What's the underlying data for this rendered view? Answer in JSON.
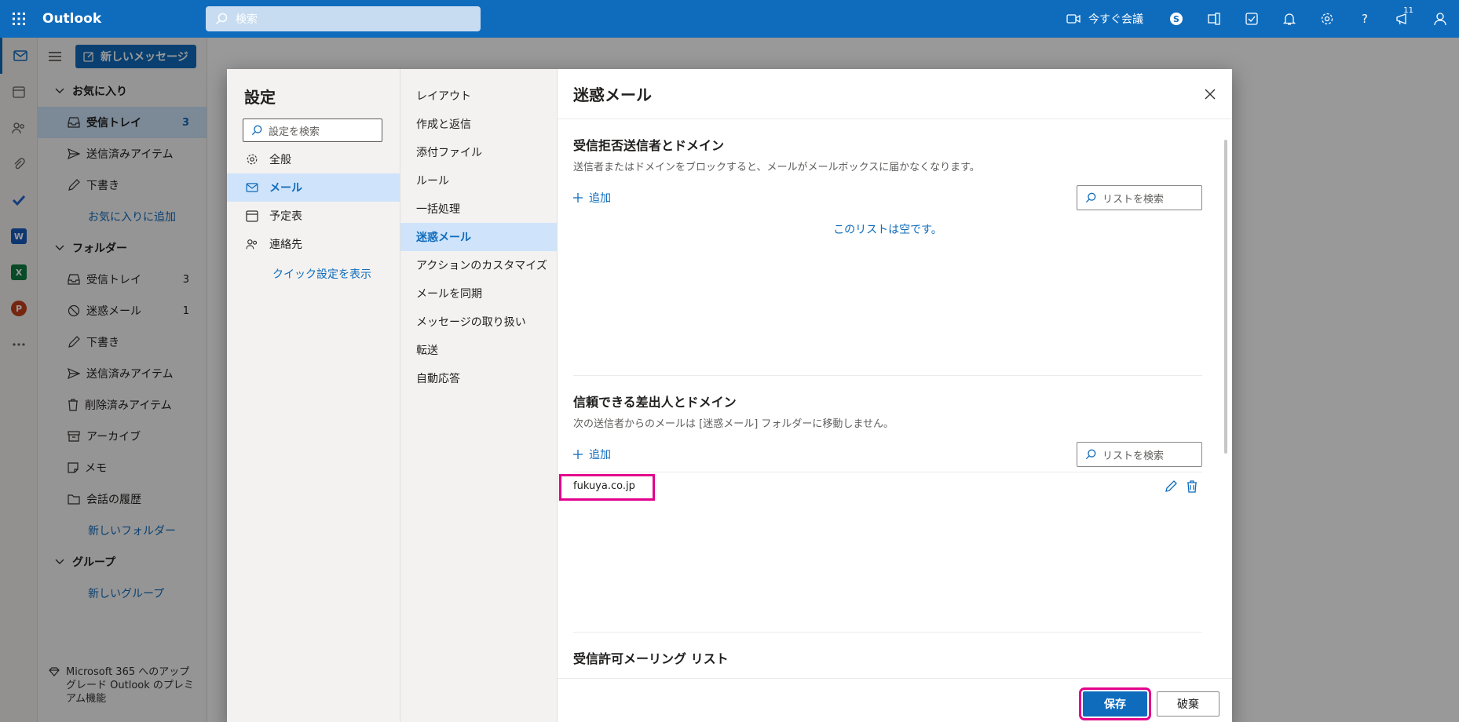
{
  "topbar": {
    "app_name": "Outlook",
    "search_placeholder": "検索",
    "meet_now": "今すぐ会議",
    "notification_count": "11"
  },
  "folder_pane": {
    "new_message": "新しいメッセージ",
    "favorites": "お気に入り",
    "favorite_items": [
      {
        "label": "受信トレイ",
        "count": "3"
      },
      {
        "label": "送信済みアイテム",
        "count": ""
      },
      {
        "label": "下書き",
        "count": ""
      }
    ],
    "add_favorite": "お気に入りに追加",
    "folders": "フォルダー",
    "folder_items": [
      {
        "label": "受信トレイ",
        "count": "3"
      },
      {
        "label": "迷惑メール",
        "count": "1"
      },
      {
        "label": "下書き",
        "count": ""
      },
      {
        "label": "送信済みアイテム",
        "count": ""
      },
      {
        "label": "削除済みアイテム",
        "count": ""
      },
      {
        "label": "アーカイブ",
        "count": ""
      },
      {
        "label": "メモ",
        "count": ""
      },
      {
        "label": "会話の履歴",
        "count": ""
      }
    ],
    "new_folder": "新しいフォルダー",
    "groups": "グループ",
    "new_group": "新しいグループ",
    "upgrade": "Microsoft 365 へのアップグレード Outlook のプレミアム機能"
  },
  "settings": {
    "title": "設定",
    "search_placeholder": "設定を検索",
    "categories": [
      "全般",
      "メール",
      "予定表",
      "連絡先"
    ],
    "quick_settings": "クイック設定を表示",
    "subcategories": [
      "レイアウト",
      "作成と返信",
      "添付ファイル",
      "ルール",
      "一括処理",
      "迷惑メール",
      "アクションのカスタマイズ",
      "メールを同期",
      "メッセージの取り扱い",
      "転送",
      "自動応答"
    ],
    "panel_title": "迷惑メール",
    "blocked": {
      "title": "受信拒否送信者とドメイン",
      "desc": "送信者またはドメインをブロックすると、メールがメールボックスに届かなくなります。",
      "add": "追加",
      "search": "リストを検索",
      "empty": "このリストは空です。"
    },
    "safe": {
      "title": "信頼できる差出人とドメイン",
      "desc": "次の送信者からのメールは [迷惑メール] フォルダーに移動しません。",
      "add": "追加",
      "search": "リストを検索",
      "entries": [
        "fukuya.co.jp"
      ]
    },
    "mailing": {
      "title": "受信許可メーリング リスト"
    },
    "save": "保存",
    "discard": "破棄"
  }
}
